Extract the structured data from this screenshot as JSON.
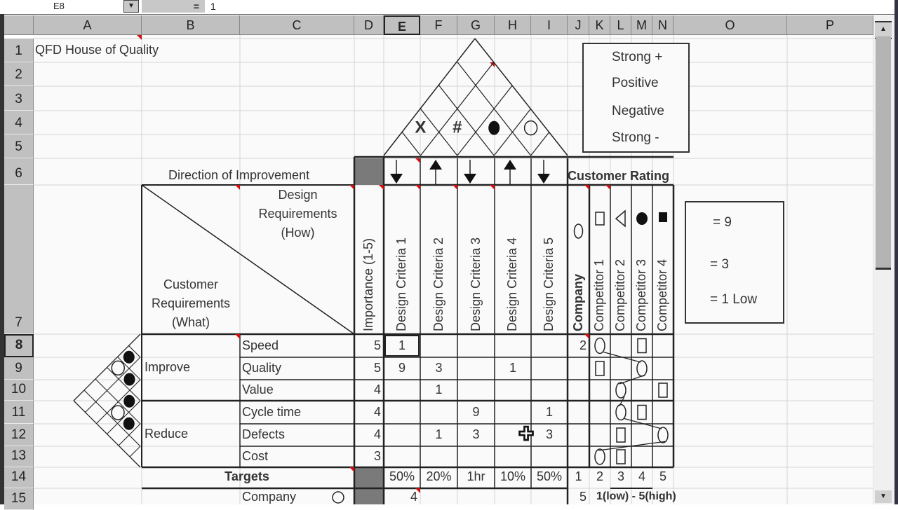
{
  "formula_bar": {
    "name_box": "E8",
    "equals": "=",
    "value": "1"
  },
  "columns": [
    "A",
    "B",
    "C",
    "D",
    "E",
    "F",
    "G",
    "H",
    "I",
    "J",
    "K",
    "L",
    "M",
    "N",
    "O",
    "P"
  ],
  "selected_column": "E",
  "rows": [
    "1",
    "2",
    "3",
    "4",
    "5",
    "6",
    "7",
    "8",
    "9",
    "10",
    "11",
    "12",
    "13",
    "14",
    "15"
  ],
  "selected_row": "8",
  "title": "QFD House of Quality",
  "direction_label": "Direction of Improvement",
  "directions": [
    "down",
    "up",
    "down",
    "up",
    "down"
  ],
  "roof_legend": [
    {
      "symbol": "strong-plus",
      "label": "Strong +"
    },
    {
      "symbol": "positive",
      "label": "Positive"
    },
    {
      "symbol": "negative",
      "label": "Negative"
    },
    {
      "symbol": "strong-minus",
      "label": "Strong -"
    }
  ],
  "roof_marks": [
    {
      "symbol": "#",
      "between": [
        2,
        3
      ]
    },
    {
      "symbol": "dot",
      "between": [
        3,
        4
      ]
    },
    {
      "symbol": "X",
      "between": [
        1,
        2
      ]
    },
    {
      "symbol": "circle",
      "between": [
        4,
        5
      ]
    }
  ],
  "customer_rating_label": "Customer Rating",
  "header": {
    "design_requirements": [
      "Design",
      "Requirements",
      "(How)"
    ],
    "customer_requirements": [
      "Customer",
      "Requirements",
      "(What)"
    ],
    "importance": "Importance (1-5)",
    "design_criteria": [
      "Design Criteria 1",
      "Design Criteria 2",
      "Design Criteria 3",
      "Design Criteria 4",
      "Design Criteria 5"
    ],
    "competitors": [
      {
        "label": "Company",
        "symbol": "circle"
      },
      {
        "label": "Competitor 1",
        "symbol": "square-outline"
      },
      {
        "label": "Competitor 2",
        "symbol": "triangle-left"
      },
      {
        "label": "Competitor 3",
        "symbol": "dot"
      },
      {
        "label": "Competitor 4",
        "symbol": "square-filled"
      }
    ]
  },
  "relationship_legend": [
    {
      "symbol": "bullseye",
      "label": "= 9"
    },
    {
      "symbol": "circle",
      "label": "= 3"
    },
    {
      "symbol": "triangle",
      "label": "= 1 Low"
    }
  ],
  "groups": [
    {
      "label": "Improve",
      "rows": [
        0,
        1,
        2
      ]
    },
    {
      "label": "Reduce",
      "rows": [
        3,
        4,
        5
      ]
    }
  ],
  "requirements": [
    {
      "name": "Speed",
      "importance": "5",
      "values": [
        "1",
        "",
        "",
        "",
        ""
      ],
      "company_rating": "2",
      "competitor_marks": {
        "circle": 2,
        "square": 4
      }
    },
    {
      "name": "Quality",
      "importance": "5",
      "values": [
        "9",
        "3",
        "",
        "1",
        ""
      ],
      "company_rating": "",
      "competitor_marks": {
        "square": 2,
        "circle": 4
      }
    },
    {
      "name": "Value",
      "importance": "4",
      "values": [
        "",
        "1",
        "",
        "",
        ""
      ],
      "company_rating": "",
      "competitor_marks": {
        "circle": 3,
        "square": 5
      }
    },
    {
      "name": "Cycle time",
      "importance": "4",
      "values": [
        "",
        "",
        "9",
        "",
        "1"
      ],
      "company_rating": "",
      "competitor_marks": {
        "circle": 3,
        "square": 4
      }
    },
    {
      "name": "Defects",
      "importance": "4",
      "values": [
        "",
        "1",
        "3",
        "",
        "3"
      ],
      "company_rating": "",
      "competitor_marks": {
        "square": 3,
        "circle": 5
      }
    },
    {
      "name": "Cost",
      "importance": "3",
      "values": [
        "",
        "",
        "",
        "",
        ""
      ],
      "company_rating": "",
      "competitor_marks": {
        "circle": 2,
        "square": 3
      }
    }
  ],
  "correlation_marks": [
    {
      "row_pair": [
        0,
        1
      ],
      "symbol": "dot"
    },
    {
      "row_pair": [
        0,
        2
      ],
      "symbol": "circle"
    },
    {
      "row_pair": [
        1,
        2
      ],
      "symbol": "dot"
    },
    {
      "row_pair": [
        2,
        3
      ],
      "symbol": "dot"
    },
    {
      "row_pair": [
        2,
        4
      ],
      "symbol": "circle"
    },
    {
      "row_pair": [
        3,
        4
      ],
      "symbol": "dot"
    }
  ],
  "targets": {
    "label": "Targets",
    "values": [
      "50%",
      "20%",
      "1hr",
      "10%",
      "50%"
    ]
  },
  "rating_scale": [
    "1",
    "2",
    "3",
    "4",
    "5"
  ],
  "row15": {
    "label": "Company",
    "e_value": "4",
    "j_value": "5",
    "scale_note": "1(low) - 5(high)"
  },
  "colors": {
    "header_gray": "#c0c0c0",
    "dark_fill": "#7a7a7a",
    "comment_red": "#d01010"
  }
}
